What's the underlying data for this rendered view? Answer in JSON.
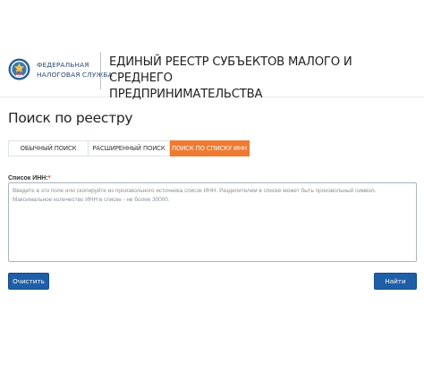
{
  "header": {
    "logo_line1": "ФЕДЕРАЛЬНАЯ",
    "logo_line2": "НАЛОГОВАЯ СЛУЖБА",
    "title_line1": "ЕДИНЫЙ РЕЕСТР СУБЪЕКТОВ МАЛОГО И СРЕДНЕГО",
    "title_line2": "ПРЕДПРИНИМАТЕЛЬСТВА",
    "logo_icon": "fns-emblem-icon"
  },
  "main": {
    "title": "Поиск по реестру",
    "tabs": [
      {
        "label": "ОБЫЧНЫЙ ПОИСК",
        "active": false
      },
      {
        "label": "РАСШИРЕННЫЙ ПОИСК",
        "active": false
      },
      {
        "label": "ПОИСК ПО СПИСКУ ИНН",
        "active": true
      }
    ],
    "inn_field": {
      "label": "Список ИНН:",
      "required_mark": "*",
      "value": "",
      "placeholder": "Введите в это поле или скопируйте из произвольного источника список ИНН. Разделителем в списке может быть произвольный символ. Максимальное количество ИНН в списке - не более 30000."
    },
    "buttons": {
      "clear_label": "Очистить",
      "find_label": "Найти"
    }
  },
  "colors": {
    "accent_tab": "#ee7a31",
    "button_primary": "#1f5fa8",
    "required": "#d9321f",
    "logo_blue": "#2b4a6f"
  }
}
